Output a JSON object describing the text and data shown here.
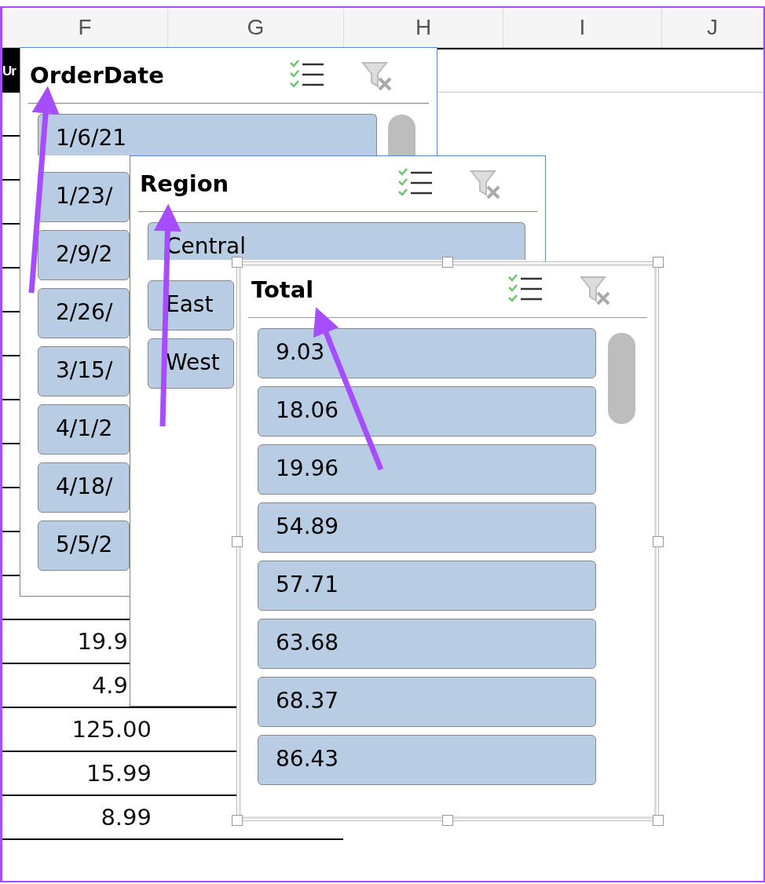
{
  "columns": [
    "F",
    "G",
    "H",
    "I",
    "J"
  ],
  "cells": [
    {
      "kind": "dark",
      "text": "Ur"
    },
    {
      "kind": "number",
      "text": "19.9"
    },
    {
      "kind": "number",
      "text": "4.9"
    },
    {
      "kind": "number",
      "text": "125.00"
    },
    {
      "kind": "number",
      "text": "15.99"
    },
    {
      "kind": "number",
      "text": "8.99"
    }
  ],
  "slicers": [
    {
      "title": "OrderDate",
      "selected": false,
      "scrollbar": true,
      "items": [
        {
          "text": "1/6/21",
          "selected": true
        },
        {
          "text": "1/23/",
          "selected": true
        },
        {
          "text": "2/9/2",
          "selected": true
        },
        {
          "text": "2/26/",
          "selected": true
        },
        {
          "text": "3/15/",
          "selected": true
        },
        {
          "text": "4/1/2",
          "selected": true
        },
        {
          "text": "4/18/",
          "selected": true
        },
        {
          "text": "5/5/2",
          "selected": true
        }
      ]
    },
    {
      "title": "Region",
      "selected": false,
      "scrollbar": false,
      "items": [
        {
          "text": "Central",
          "selected": true
        },
        {
          "text": "East",
          "selected": true
        },
        {
          "text": "West",
          "selected": true
        }
      ]
    },
    {
      "title": "Total",
      "selected": true,
      "scrollbar": true,
      "items": [
        {
          "text": "9.03",
          "selected": true
        },
        {
          "text": "18.06",
          "selected": true
        },
        {
          "text": "19.96",
          "selected": true
        },
        {
          "text": "54.89",
          "selected": true
        },
        {
          "text": "57.71",
          "selected": true
        },
        {
          "text": "63.68",
          "selected": true
        },
        {
          "text": "68.37",
          "selected": true
        },
        {
          "text": "86.43",
          "selected": true
        }
      ]
    }
  ]
}
